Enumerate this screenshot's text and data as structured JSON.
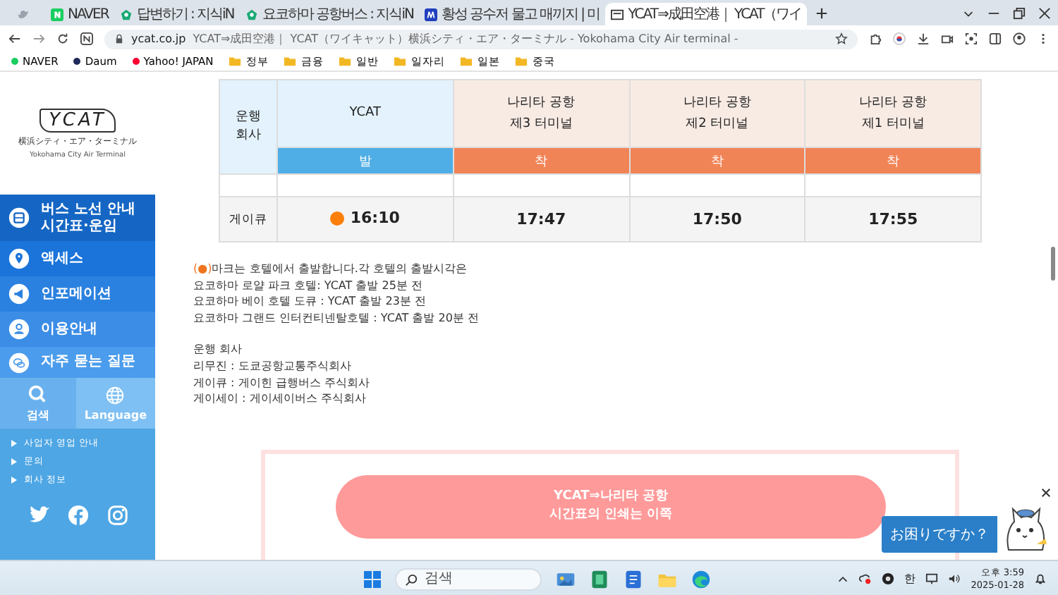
{
  "browser": {
    "tabs": [
      {
        "kind": "bird",
        "selected": false
      },
      {
        "title": "NAVER",
        "kind": "naver",
        "selected": false
      },
      {
        "title": "답변하기 : 지식iN",
        "kind": "kin",
        "selected": false
      },
      {
        "title": "요코하마 공항버스 : 지식iN",
        "kind": "kin",
        "selected": false
      },
      {
        "title": "황성 공수저 물고 매끼지 | 미",
        "kind": "m",
        "selected": false
      },
      {
        "title": "YCAT⇒成田空港｜ YCAT（ワイ",
        "kind": "ycat",
        "selected": true
      }
    ],
    "address": {
      "domain": "ycat.co.jp",
      "title": "YCAT⇒成田空港｜ YCAT（ワイキャット）横浜シティ・エア・ターミナル - Yokohama City Air terminal -"
    },
    "bookmarks": [
      {
        "label": "NAVER",
        "kind": "site",
        "color": "#19ce60"
      },
      {
        "label": "Daum",
        "kind": "site",
        "color": "#1e2a5a"
      },
      {
        "label": "Yahoo! JAPAN",
        "kind": "site",
        "color": "#ff0033"
      },
      {
        "label": "정부",
        "kind": "folder"
      },
      {
        "label": "금융",
        "kind": "folder"
      },
      {
        "label": "일반",
        "kind": "folder"
      },
      {
        "label": "일자리",
        "kind": "folder"
      },
      {
        "label": "일본",
        "kind": "folder"
      },
      {
        "label": "중국",
        "kind": "folder"
      }
    ]
  },
  "sidebar": {
    "logo": {
      "wordmark": "YCAT",
      "name_ja": "横浜シティ・エア・ターミナル",
      "name_en": "Yokohama City Air Terminal"
    },
    "menu": [
      {
        "label": "버스 노선 안내\n시간표·운임",
        "kind": "bus"
      },
      {
        "label": "액세스",
        "kind": "pin"
      },
      {
        "label": "인포메이션",
        "kind": "megaphone"
      },
      {
        "label": "이용안내",
        "kind": "person"
      },
      {
        "label": "자주 묻는 질문",
        "kind": "chat"
      }
    ],
    "tools": [
      {
        "label": "검색",
        "kind": "search"
      },
      {
        "label": "Language",
        "kind": "globe"
      }
    ],
    "links": [
      "사업자 영업 안내",
      "문의",
      "회사 정보"
    ]
  },
  "timetable": {
    "corner": "운행\n회사",
    "columns": [
      {
        "label": "YCAT",
        "sub": "발",
        "kind": "departure"
      },
      {
        "label": "나리타 공항\n제3 터미널",
        "sub": "착",
        "kind": "arrival"
      },
      {
        "label": "나리타 공항\n제2 터미널",
        "sub": "착",
        "kind": "arrival"
      },
      {
        "label": "나리타 공항\n제1 터미널",
        "sub": "착",
        "kind": "arrival"
      }
    ],
    "rows": [
      {
        "company": "게이큐",
        "hotel_mark": true,
        "times": [
          "16:10",
          "17:47",
          "17:50",
          "17:55"
        ]
      }
    ]
  },
  "notes": {
    "mark": "(●)",
    "lines": [
      "마크는 호텔에서 출발합니다.각 호텔의 출발시각은",
      "요코하마 로얄 파크 호텔: YCAT 출발 25분 전",
      "요코하마 베이 호텔 도큐 : YCAT 출발 23분 전",
      "요코하마 그랜드 인터컨티넨탈호텔 : YCAT 출발 20분 전"
    ],
    "operators": [
      "운행 회사",
      "리무진 : 도쿄공항교통주식회사",
      "게이큐 : 게이힌 급행버스 주식회사",
      "게이세이 : 게이세이버스 주식회사"
    ]
  },
  "print_button": "YCAT⇒나리타 공항\n시간표의 인쇄는 이쪽",
  "chat_widget": {
    "label": "お困りですか？"
  },
  "taskbar": {
    "search_placeholder": "검색",
    "ime": "한",
    "time": "오후 3:59",
    "date": "2025-01-28"
  }
}
